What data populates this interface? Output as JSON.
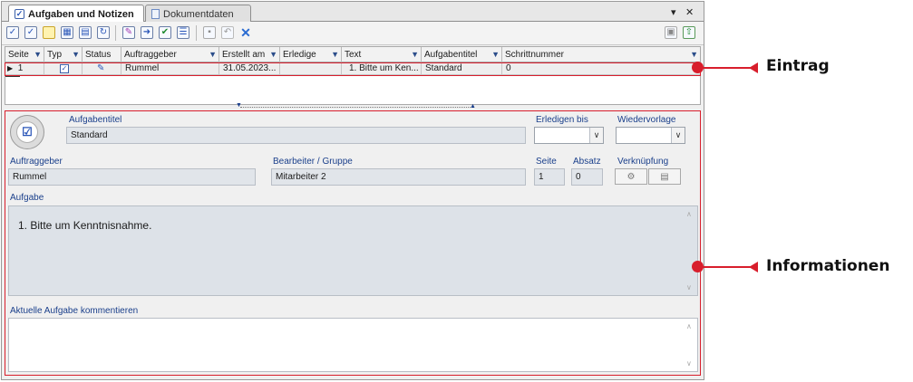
{
  "tabs": [
    {
      "label": "Aufgaben und Notizen",
      "icon": "task-icon",
      "active": true
    },
    {
      "label": "Dokumentdaten",
      "icon": "document-icon",
      "active": false
    }
  ],
  "tab_controls": {
    "menu": "▾",
    "close": "✕"
  },
  "grid": {
    "columns": [
      "Seite",
      "Typ",
      "Status",
      "Auftraggeber",
      "Erstellt am",
      "Erledige",
      "Text",
      "Aufgabentitel",
      "Schrittnummer"
    ],
    "row": {
      "indicator": "▶",
      "seite": "1",
      "typ_checked": true,
      "status_icon": "pencil-icon",
      "auftraggeber": "Rummel",
      "erstellt_am": "31.05.2023...",
      "erledige": "",
      "text": "1. Bitte um Ken...",
      "aufgabentitel": "Standard",
      "schrittnummer": "0"
    }
  },
  "detail": {
    "aufgabentitel_label": "Aufgabentitel",
    "aufgabentitel_value": "Standard",
    "erledigen_bis_label": "Erledigen bis",
    "wiedervorlage_label": "Wiedervorlage",
    "auftraggeber_label": "Auftraggeber",
    "auftraggeber_value": "Rummel",
    "bearbeiter_label": "Bearbeiter / Gruppe",
    "bearbeiter_value": "Mitarbeiter 2",
    "seite_label": "Seite",
    "seite_value": "1",
    "absatz_label": "Absatz",
    "absatz_value": "0",
    "verknuepfung_label": "Verknüpfung",
    "aufgabe_label": "Aufgabe",
    "aufgabe_text": "1. Bitte um Kenntnisnahme.",
    "kommentar_label": "Aktuelle Aufgabe kommentieren",
    "kommentar_text": ""
  },
  "callouts": {
    "eintrag": "Eintrag",
    "informationen": "Informationen"
  },
  "colors": {
    "accent_red": "#d81e2c",
    "label_blue": "#1a3f8b"
  }
}
